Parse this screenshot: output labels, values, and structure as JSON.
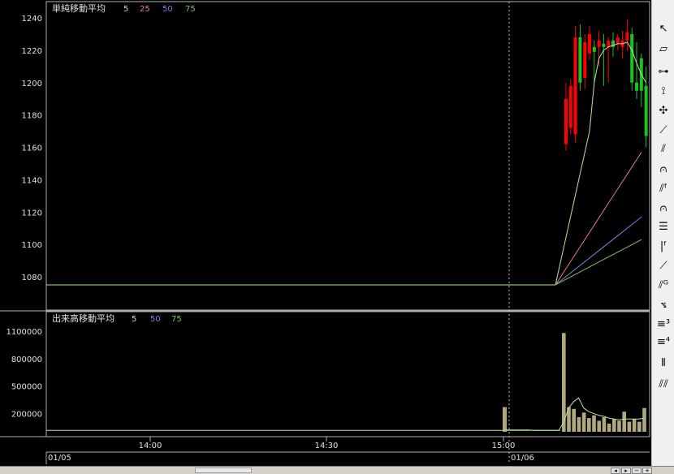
{
  "price_panel": {
    "title": "単純移動平均",
    "ma_periods": [
      "5",
      "25",
      "50",
      "75"
    ],
    "y_ticks": [
      "1240",
      "1220",
      "1200",
      "1180",
      "1160",
      "1140",
      "1120",
      "1100",
      "1080"
    ]
  },
  "volume_panel": {
    "title": "出来高移動平均",
    "ma_periods": [
      "5",
      "50",
      "75"
    ],
    "y_ticks": [
      "1100000",
      "800000",
      "500000",
      "200000"
    ]
  },
  "time_axis": {
    "ticks": [
      "14:00",
      "14:30",
      "15:00"
    ],
    "dates": [
      "01/05",
      "01/06"
    ]
  },
  "colors": {
    "ma5": "#b8e6a0",
    "ma25": "#e08080",
    "ma50": "#8080e0",
    "ma75": "#80c060",
    "up_candle": "#ff0000",
    "down_candle": "#20c020",
    "volume_bar": "#b0a880",
    "grid": "#b0b0b0"
  },
  "toolbar": {
    "icons": [
      "cursor-icon",
      "eraser-icon",
      "horizontal-line-icon",
      "vertical-line-icon",
      "cross-line-icon",
      "trend-line-icon",
      "fan-line-icon",
      "arc-icon",
      "fibonacci-fan-icon",
      "fibonacci-arc-icon",
      "fibonacci-retracement-icon",
      "fibonacci-time-icon",
      "regression-line-icon",
      "gann-fan-icon",
      "channel-icon",
      "three-line-icon",
      "four-line-icon",
      "cycle-line-icon",
      "zigzag-icon"
    ]
  },
  "chart_data": [
    {
      "type": "candlestick",
      "title": "単純移動平均",
      "ylim": [
        1070,
        1245
      ],
      "candles": [
        {
          "o": 1162,
          "h": 1200,
          "l": 1158,
          "c": 1190
        },
        {
          "o": 1172,
          "h": 1202,
          "l": 1168,
          "c": 1198
        },
        {
          "o": 1168,
          "h": 1235,
          "l": 1163,
          "c": 1228
        },
        {
          "o": 1228,
          "h": 1236,
          "l": 1195,
          "c": 1200
        },
        {
          "o": 1203,
          "h": 1230,
          "l": 1196,
          "c": 1225
        },
        {
          "o": 1218,
          "h": 1235,
          "l": 1214,
          "c": 1230
        },
        {
          "o": 1222,
          "h": 1226,
          "l": 1200,
          "c": 1219
        },
        {
          "o": 1222,
          "h": 1232,
          "l": 1210,
          "c": 1226
        },
        {
          "o": 1224,
          "h": 1230,
          "l": 1198,
          "c": 1222
        },
        {
          "o": 1222,
          "h": 1228,
          "l": 1200,
          "c": 1226
        },
        {
          "o": 1226,
          "h": 1231,
          "l": 1216,
          "c": 1222
        },
        {
          "o": 1224,
          "h": 1230,
          "l": 1220,
          "c": 1228
        },
        {
          "o": 1222,
          "h": 1232,
          "l": 1215,
          "c": 1226
        },
        {
          "o": 1226,
          "h": 1239,
          "l": 1220,
          "c": 1231
        },
        {
          "o": 1230,
          "h": 1234,
          "l": 1195,
          "c": 1200
        },
        {
          "o": 1200,
          "h": 1225,
          "l": 1190,
          "c": 1195
        },
        {
          "o": 1215,
          "h": 1218,
          "l": 1185,
          "c": 1195
        },
        {
          "o": 1198,
          "h": 1210,
          "l": 1160,
          "c": 1167
        }
      ],
      "ma5": [
        1075,
        1078,
        1090,
        1110,
        1140,
        1170,
        1200,
        1215,
        1220,
        1222,
        1223,
        1224,
        1224,
        1225,
        1220,
        1212,
        1205,
        1200
      ],
      "ma25_range": [
        1075,
        1157
      ],
      "ma50_range": [
        1075,
        1117
      ],
      "ma75_range": [
        1075,
        1103
      ],
      "pre_market_value": 1075
    },
    {
      "type": "bar",
      "title": "出来高移動平均",
      "ylim": [
        0,
        1250000
      ],
      "pre_market_value": 15000,
      "isolated_bar": 270000,
      "values": [
        1080000,
        270000,
        250000,
        160000,
        210000,
        150000,
        180000,
        120000,
        160000,
        90000,
        140000,
        120000,
        220000,
        110000,
        140000,
        110000,
        260000
      ],
      "ma5": [
        100000,
        260000,
        330000,
        370000,
        260000,
        220000,
        200000,
        180000,
        170000,
        150000,
        140000,
        130000,
        140000,
        140000,
        140000,
        140000,
        150000
      ]
    }
  ]
}
